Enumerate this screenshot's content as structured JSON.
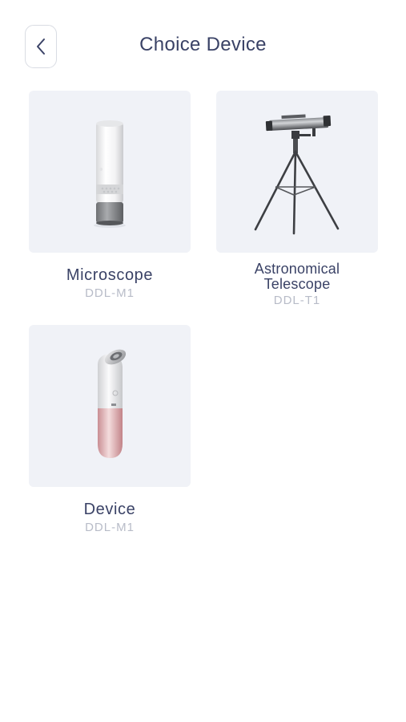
{
  "header": {
    "title": "Choice Device",
    "back_icon": "chevron-left-icon"
  },
  "devices": [
    {
      "name": "Microscope",
      "model": "DDL-M1",
      "image": "microscope-image"
    },
    {
      "name_line1": "Astronomical",
      "name_line2": "Telescope",
      "model": "DDL-T1",
      "image": "telescope-image"
    },
    {
      "name": "Device",
      "model": "DDL-M1",
      "image": "beauty-device-image"
    }
  ]
}
